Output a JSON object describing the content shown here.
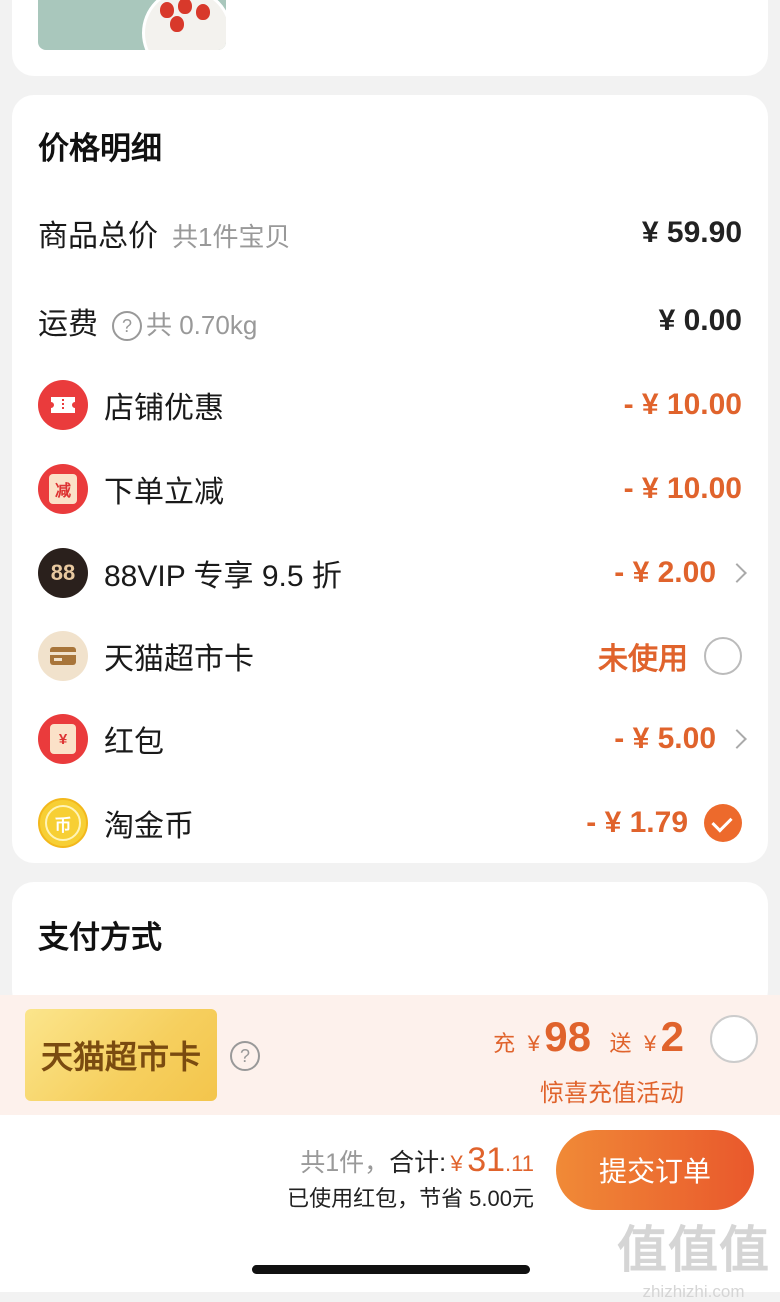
{
  "price_detail": {
    "title": "价格明细",
    "goods_total": {
      "label": "商品总价",
      "sub": "共1件宝贝",
      "amount": "¥ 59.90"
    },
    "shipping": {
      "label": "运费",
      "help": "?",
      "sub": "共 0.70kg",
      "amount": "¥ 0.00"
    },
    "discounts": [
      {
        "label": "店铺优惠",
        "amount": "- ¥ 10.00"
      },
      {
        "label": "下单立减",
        "amount": "- ¥ 10.00",
        "icon_text": "减"
      },
      {
        "label": "88VIP 专享 9.5 折",
        "amount": "- ¥ 2.00",
        "icon_text": "88"
      },
      {
        "label": "天猫超市卡",
        "amount": "未使用"
      },
      {
        "label": "红包",
        "amount": "- ¥ 5.00",
        "icon_text": "¥"
      },
      {
        "label": "淘金币",
        "amount": "- ¥ 1.79",
        "icon_text": "币"
      }
    ]
  },
  "payment": {
    "title": "支付方式",
    "promo": {
      "card_label": "天猫超市卡",
      "help": "?",
      "recharge_word": "充",
      "currency": "¥",
      "recharge_amount": "98",
      "gift_word": "送",
      "gift_amount": "2",
      "activity": "惊喜充值活动"
    }
  },
  "footer": {
    "count": "共1件，",
    "total_label": "合计:",
    "currency": "¥",
    "total_int": "31",
    "total_dec": ".11",
    "saved": "已使用红包，节省 5.00元",
    "submit": "提交订单"
  },
  "watermark": {
    "line1": "值值值",
    "line2": "zhizhizhi.com"
  },
  "colors": {
    "accent": "#e0632c",
    "submit_start": "#f08a37",
    "submit_end": "#e9582c",
    "background": "#f2f2f2"
  }
}
